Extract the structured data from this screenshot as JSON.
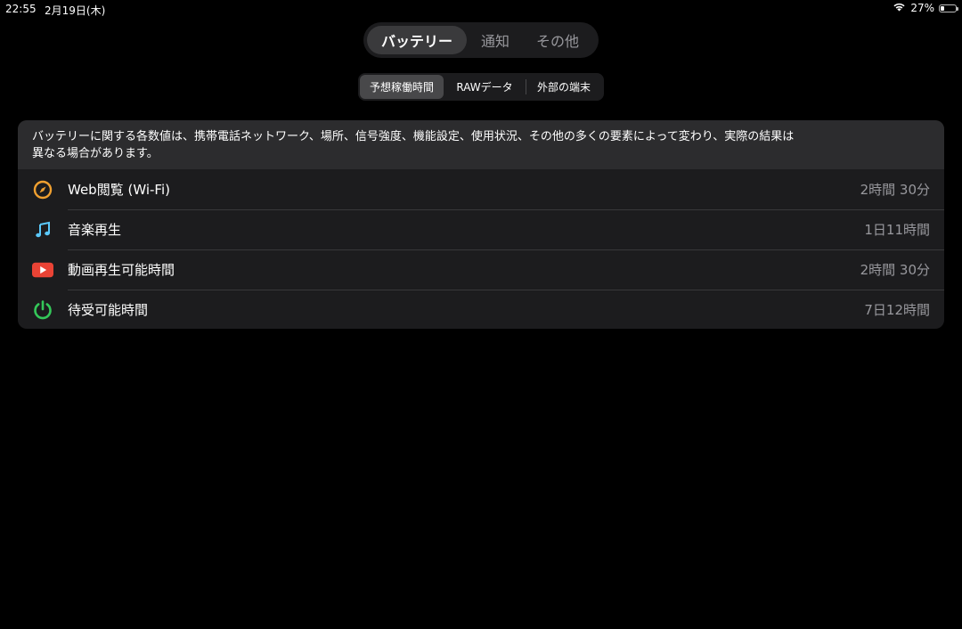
{
  "status_bar": {
    "time": "22:55",
    "date": "2月19日(木)",
    "battery_percent_label": "27%",
    "battery_level": 0.27
  },
  "main_tabs": [
    {
      "label": "バッテリー",
      "active": true
    },
    {
      "label": "通知",
      "active": false
    },
    {
      "label": "その他",
      "active": false
    }
  ],
  "sub_tabs": [
    {
      "label": "予想稼働時間",
      "active": true
    },
    {
      "label": "RAWデータ",
      "active": false
    },
    {
      "label": "外部の端末",
      "active": false
    }
  ],
  "notice": {
    "line1": "バッテリーに関する各数値は、携帯電話ネットワーク、場所、信号強度、機能設定、使用状況、その他の多くの要素によって変わり、実際の結果は",
    "line2": "異なる場合があります。"
  },
  "rows": [
    {
      "label": "Web閲覧 (Wi-Fi)",
      "value": "2時間 30分",
      "icon": "compass-icon",
      "icon_color": "#f0a030"
    },
    {
      "label": "音楽再生",
      "value": "1日11時間",
      "icon": "music-note-icon",
      "icon_color": "#5ac8fa"
    },
    {
      "label": "動画再生可能時間",
      "value": "2時間 30分",
      "icon": "video-play-icon",
      "icon_color": "#ea4335"
    },
    {
      "label": "待受可能時間",
      "value": "7日12時間",
      "icon": "power-icon",
      "icon_color": "#34c759"
    }
  ],
  "colors": {
    "background": "#000000",
    "card": "#1c1c1e",
    "notice_bg": "#2c2c2e",
    "secondary_text": "#98989d"
  }
}
